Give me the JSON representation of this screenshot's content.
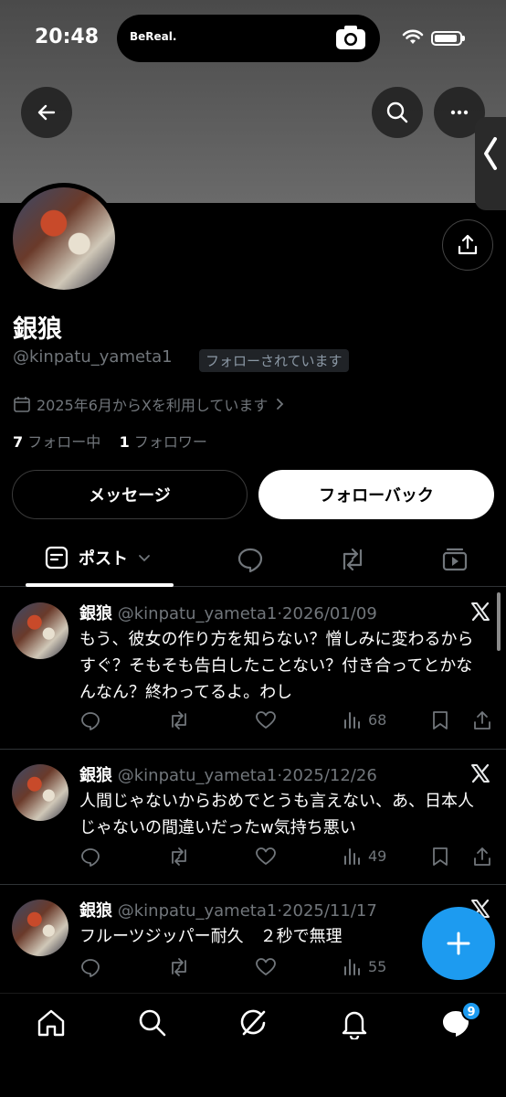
{
  "status_bar": {
    "time": "20:48",
    "island_app": "BeReal."
  },
  "profile": {
    "display_name": "銀狼",
    "handle": "@kinpatu_yameta1",
    "follows_you": "フォローされています",
    "joined": "2025年6月からXを利用しています",
    "following_count": "7",
    "following_label": "フォロー中",
    "followers_count": "1",
    "followers_label": "フォロワー"
  },
  "buttons": {
    "message": "メッセージ",
    "follow_back": "フォローバック"
  },
  "tabs": {
    "posts": "ポスト"
  },
  "posts": [
    {
      "name": "銀狼",
      "meta": "@kinpatu_yameta1·2026/01/09",
      "text": "もう、彼女の作り方を知らない？憎しみに変わるからすぐ？そもそも告白したことない？付き合ってとかなんなん？終わってるよ。わし",
      "views": "68"
    },
    {
      "name": "銀狼",
      "meta": "@kinpatu_yameta1·2025/12/26",
      "text": "人間じゃないからおめでとうも言えない、あ、日本人じゃないの間違いだったw気持ち悪い",
      "views": "49"
    },
    {
      "name": "銀狼",
      "meta": "@kinpatu_yameta1·2025/11/17",
      "text": "フルーツジッパー耐久　２秒で無理",
      "views": "55"
    }
  ],
  "nav": {
    "messages_badge": "9"
  },
  "colors": {
    "accent": "#1d9bf0",
    "background": "#000000",
    "muted": "#71767b"
  }
}
